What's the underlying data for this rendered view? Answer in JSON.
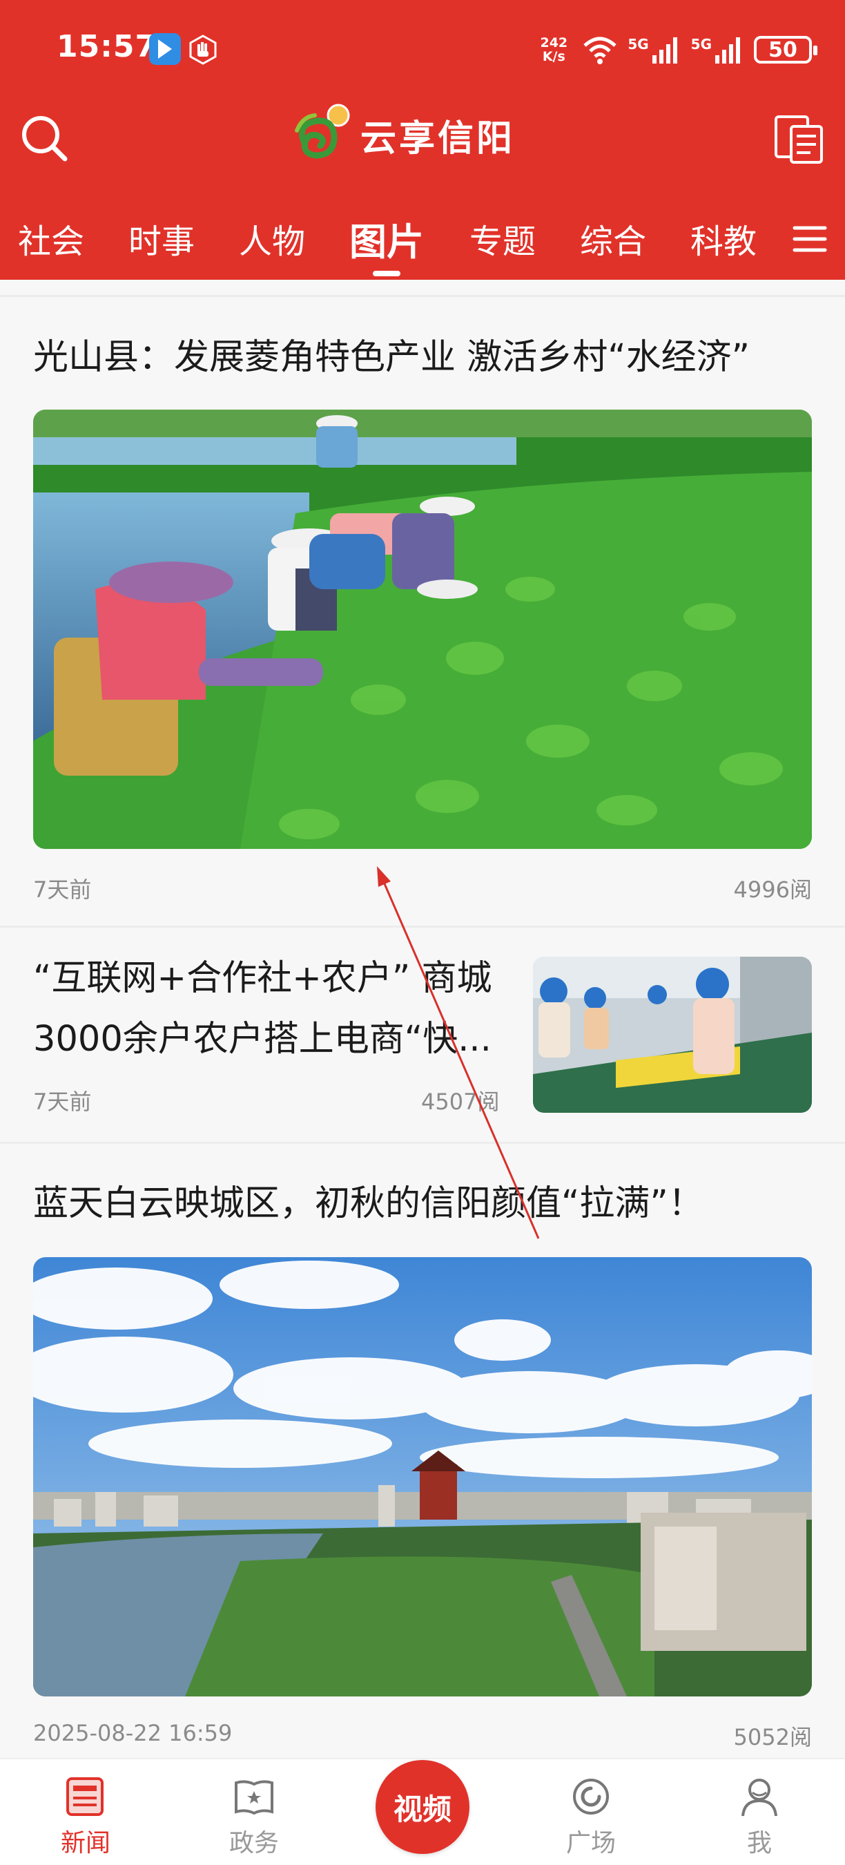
{
  "status_bar": {
    "time": "15:57",
    "net_speed_value": "242",
    "net_speed_unit": "K/s",
    "signal_1": "5G",
    "signal_2": "5G",
    "battery": "50"
  },
  "header": {
    "logo_text": "云享信阳",
    "read_paper_icon": "read-newspaper-icon",
    "search_icon": "search-icon"
  },
  "nav": {
    "tabs": [
      "社会",
      "时事",
      "人物",
      "图片",
      "专题",
      "综合",
      "科教"
    ],
    "active_tab": "图片",
    "menu_icon": "hamburger-menu-icon"
  },
  "articles": [
    {
      "title": "光山县：发展菱角特色产业 激活乡村“水经济”",
      "time": "7天前",
      "reads": "4996阅"
    },
    {
      "title_line1": "“互联网+合作社+农户” 商城",
      "title_line2": "3000余户农户搭上电商“快...",
      "time": "7天前",
      "reads": "4507阅"
    },
    {
      "title": "蓝天白云映城区，初秋的信阳颜值“拉满”！",
      "time": "2025-08-22 16:59",
      "reads": "5052阅"
    }
  ],
  "bottom_nav": {
    "items": [
      "新闻",
      "政务",
      "视频",
      "广场",
      "我"
    ],
    "active": "新闻"
  },
  "colors": {
    "brand_red": "#e1322a",
    "meta_gray": "#8a8a8a"
  }
}
